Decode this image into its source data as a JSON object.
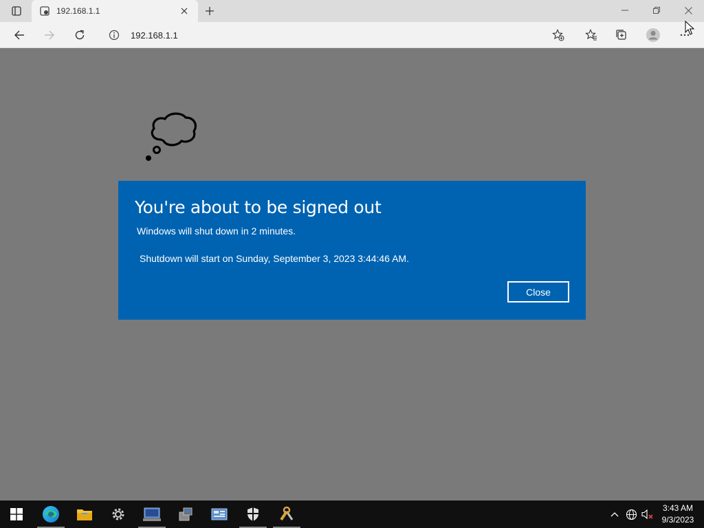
{
  "browser": {
    "tab_title": "192.168.1.1",
    "address_url": "192.168.1.1",
    "icons": [
      "tab-actions-icon",
      "favicon-icon",
      "close-icon",
      "plus-icon",
      "minimize-icon",
      "restore-icon",
      "close-icon",
      "back-icon",
      "forward-icon",
      "refresh-icon",
      "info-icon",
      "add-favorite-icon",
      "favorites-icon",
      "collections-icon",
      "profile-icon",
      "more-icon"
    ]
  },
  "dialog": {
    "title": "You're about to be signed out",
    "message": "Windows will shut down in 2 minutes.",
    "shutdown_time": "Shutdown will start on Sunday, September 3, 2023 3:44:46 AM.",
    "close_label": "Close",
    "background_color": "#0063b1"
  },
  "taskbar": {
    "apps": [
      "start-icon",
      "edge-icon",
      "file-explorer-icon",
      "settings-icon",
      "server-manager-icon",
      "network-icon",
      "control-panel-icon",
      "security-icon",
      "tools-icon"
    ],
    "clock": {
      "time": "3:43 AM",
      "date": "9/3/2023"
    }
  }
}
